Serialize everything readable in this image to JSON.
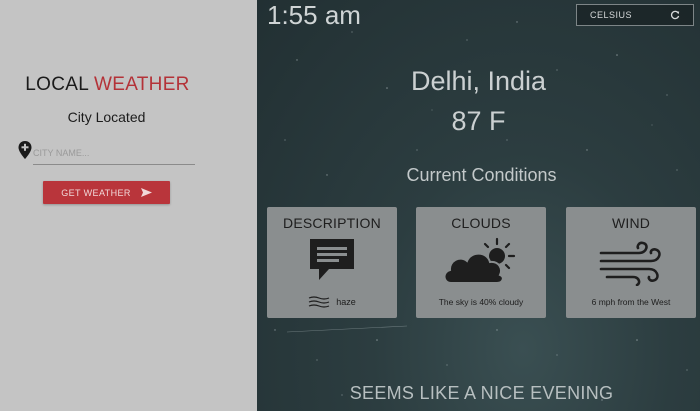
{
  "sidebar": {
    "brand_primary": "LOCAL",
    "brand_accent": "WEATHER",
    "status": "City Located",
    "city_input": {
      "placeholder": "CITY NAME...",
      "value": ""
    },
    "get_weather_label": "GET WEATHER"
  },
  "header": {
    "time": "1:55 am",
    "unit_toggle_label": "CELSIUS"
  },
  "location": {
    "city": "Delhi, India",
    "temperature": "87 F"
  },
  "conditions": {
    "heading": "Current Conditions",
    "cards": [
      {
        "title": "DESCRIPTION",
        "text": "haze",
        "icon": "chat-icon"
      },
      {
        "title": "CLOUDS",
        "text": "The sky is 40% cloudy",
        "icon": "partly-cloudy-icon"
      },
      {
        "title": "WIND",
        "text": "6 mph from the West",
        "icon": "wind-icon"
      }
    ]
  },
  "tagline": "SEEMS LIKE A NICE EVENING",
  "colors": {
    "accent": "#b9353b",
    "sidebar_bg": "#c4c4c4",
    "card_bg": "#8a8e8f"
  }
}
